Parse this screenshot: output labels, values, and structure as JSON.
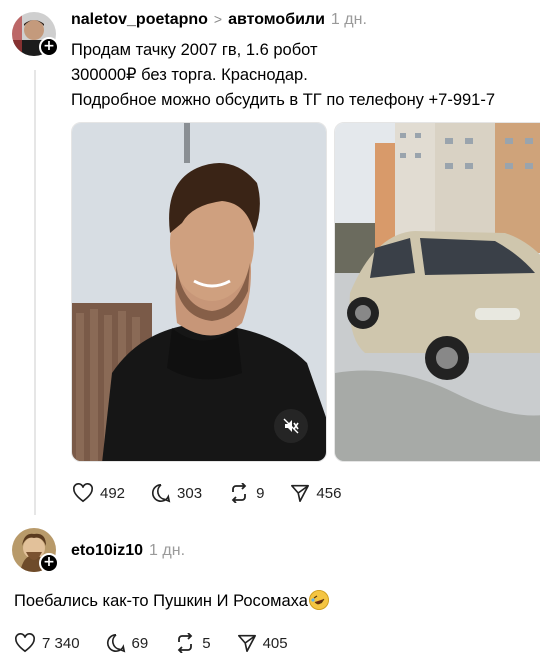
{
  "post": {
    "username": "naletov_poetapno",
    "separator": ">",
    "topic": "автомобили",
    "time": "1 дн.",
    "lines": [
      "Продам тачку 2007 гв, 1.6 робот",
      "300000₽ без торга. Краснодар.",
      "Подробное можно обсудить в ТГ по телефону +7-991-7"
    ],
    "stats": {
      "likes": "492",
      "comments": "303",
      "reposts": "9",
      "shares": "456"
    }
  },
  "reply": {
    "username": "eto10iz10",
    "time": "1 дн.",
    "text": "Поебались как-то Пушкин И Росомаха",
    "emoji": "rolling-on-floor-laughing-emoji",
    "stats": {
      "likes": "7 340",
      "comments": "69",
      "reposts": "5",
      "shares": "405"
    }
  },
  "icons": {
    "follow": "+",
    "like": "heart-icon",
    "comment": "comment-bubble-icon",
    "repost": "repost-icon",
    "share": "send-icon",
    "mute": "speaker-muted-icon"
  }
}
